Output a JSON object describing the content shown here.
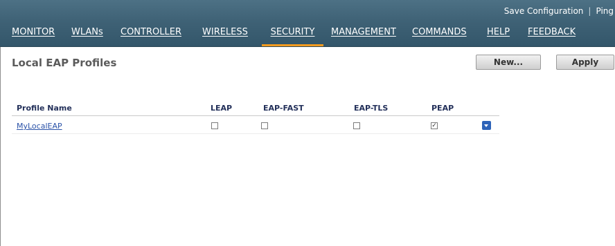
{
  "header": {
    "utility_links": [
      "Save Configuration",
      "Ping"
    ],
    "separator": "|",
    "nav": [
      "MONITOR",
      "WLANs",
      "CONTROLLER",
      "WIRELESS",
      "SECURITY",
      "MANAGEMENT",
      "COMMANDS",
      "HELP",
      "FEEDBACK"
    ],
    "active_nav": "SECURITY"
  },
  "page": {
    "title": "Local EAP Profiles",
    "new_button": "New...",
    "apply_button": "Apply"
  },
  "table": {
    "columns": [
      "Profile Name",
      "LEAP",
      "EAP-FAST",
      "EAP-TLS",
      "PEAP"
    ],
    "rows": [
      {
        "name": "MyLocalEAP",
        "leap": false,
        "eap_fast": false,
        "eap_tls": false,
        "peap": true
      }
    ]
  },
  "colors": {
    "header_bg": "#3f6276",
    "active_tab_underline": "#f59b1f",
    "link": "#2a52a8",
    "table_header_text": "#23305a"
  },
  "icons": {
    "row_action": "chevron-down-icon",
    "checked": "checkmark-icon"
  }
}
